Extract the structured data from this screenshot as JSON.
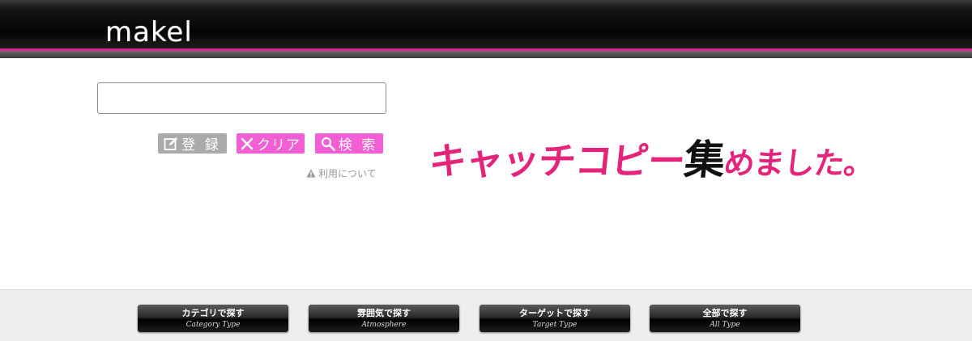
{
  "header": {
    "logo_text": "makel",
    "accent_color": "#e0259b"
  },
  "search": {
    "value": "",
    "placeholder": ""
  },
  "buttons": {
    "register_label": "登 録",
    "clear_label": "クリア",
    "search_label": "検 索"
  },
  "usage_link_label": "利用について",
  "tagline": {
    "part1": "キャッチコピー",
    "part2": "集",
    "part3": "めました。"
  },
  "nav": [
    {
      "label": "カテゴリで探す",
      "sub": "Category Type"
    },
    {
      "label": "雰囲気で探す",
      "sub": "Atmosphere"
    },
    {
      "label": "ターゲットで探す",
      "sub": "Target Type"
    },
    {
      "label": "全部で探す",
      "sub": "All Type"
    }
  ],
  "colors": {
    "pink": "#f25ed4",
    "gray_button": "#aaaaaa",
    "tagline_pink": "#e4237a"
  }
}
